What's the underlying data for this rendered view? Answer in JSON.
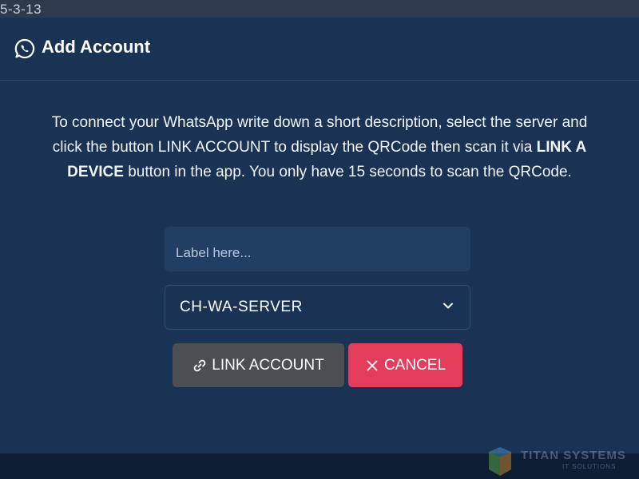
{
  "status": {
    "date_fragment": "5-3-13"
  },
  "modal": {
    "title": "Add Account",
    "title_icon": "whatsapp-icon",
    "description_parts": {
      "part1": "To connect your WhatsApp write down a short description, select the server and click the button LINK ACCOUNT to display the QRCode then scan it via ",
      "bold": "LINK A DEVICE",
      "part2": " button in the app. You only have 15 seconds to scan the QRCode."
    },
    "label_input": {
      "value": "",
      "placeholder": "Label here..."
    },
    "server_select": {
      "selected": "CH-WA-SERVER",
      "icon": "chevron-down-icon"
    },
    "buttons": {
      "link_label": "LINK ACCOUNT",
      "link_icon": "link-icon",
      "cancel_label": "CANCEL",
      "cancel_icon": "close-icon"
    }
  },
  "watermark": {
    "text": "TITAN SYSTEMS",
    "subtext": "IT SOLUTIONS"
  },
  "colors": {
    "modal_bg": "#1a3355",
    "input_bg": "#213e64",
    "link_button": "#4b4e52",
    "cancel_button": "#e43d5c"
  }
}
